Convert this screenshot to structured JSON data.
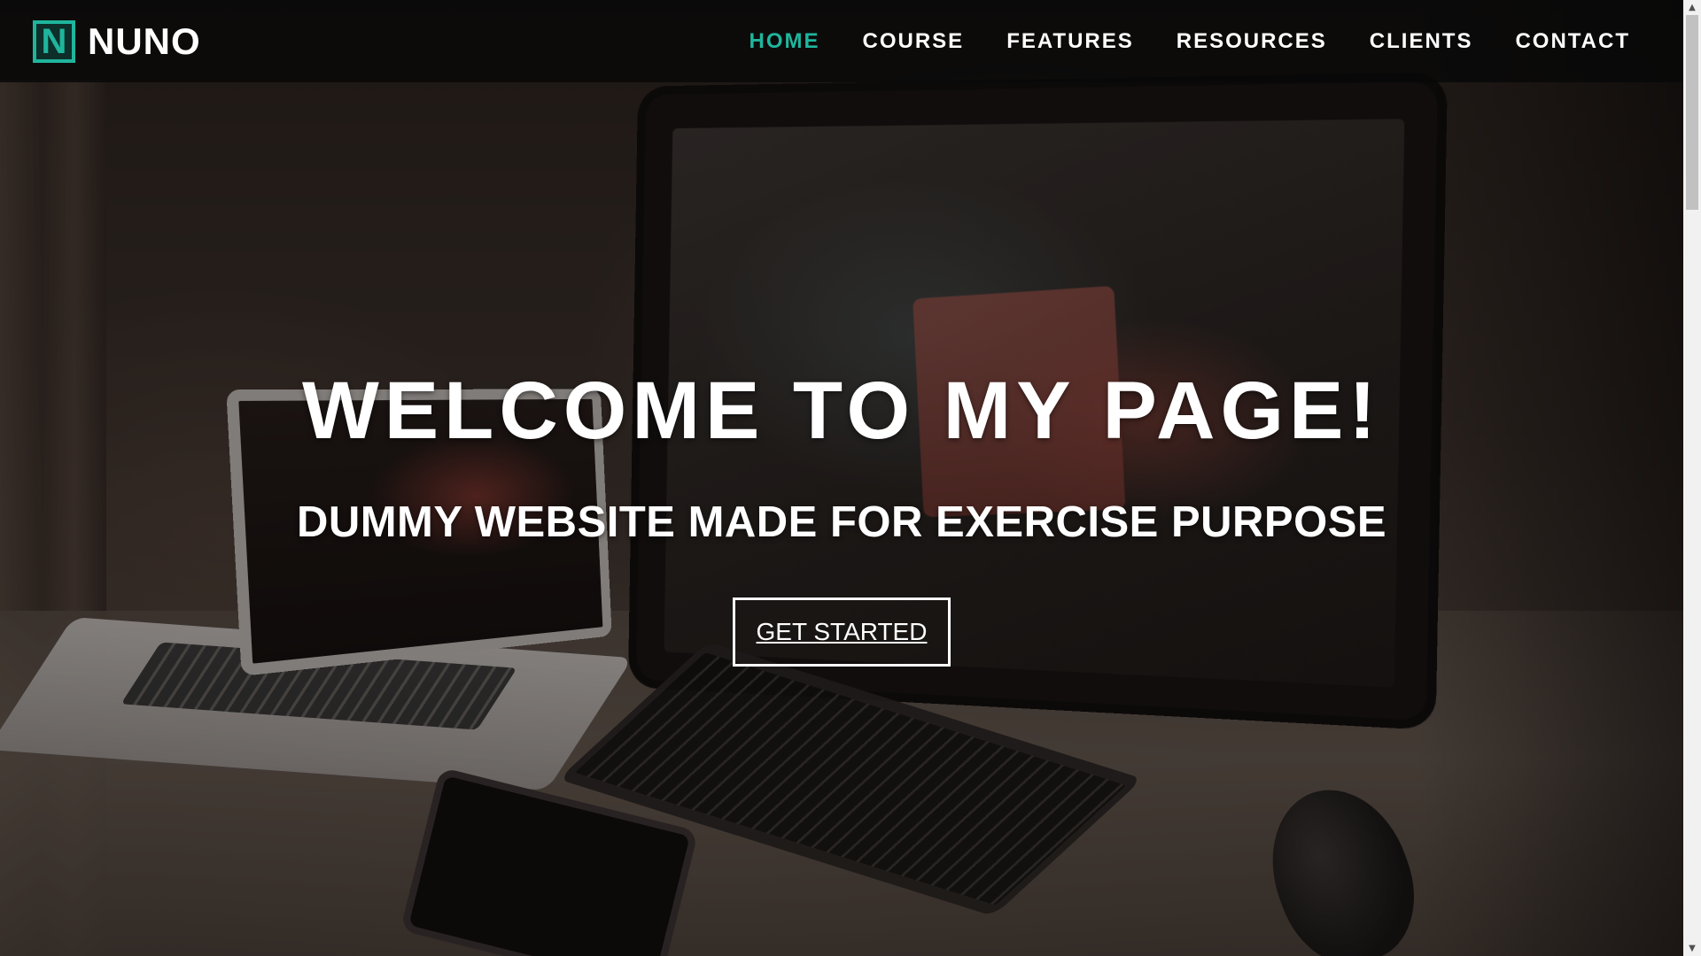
{
  "navbar": {
    "brand": {
      "logo_letter": "N",
      "name": "NUNO",
      "accent_color": "#1fb59d"
    },
    "items": [
      {
        "label": "HOME",
        "active": true
      },
      {
        "label": "COURSE",
        "active": false
      },
      {
        "label": "FEATURES",
        "active": false
      },
      {
        "label": "RESOURCES",
        "active": false
      },
      {
        "label": "CLIENTS",
        "active": false
      },
      {
        "label": "CONTACT",
        "active": false
      }
    ]
  },
  "hero": {
    "title": "WELCOME TO MY PAGE!",
    "subtitle": "DUMMY WEBSITE MADE FOR EXERCISE PURPOSE",
    "button_label": "GET STARTED"
  },
  "scrollbar": {
    "up_icon": "triangle-up-icon",
    "down_icon": "triangle-down-icon"
  }
}
